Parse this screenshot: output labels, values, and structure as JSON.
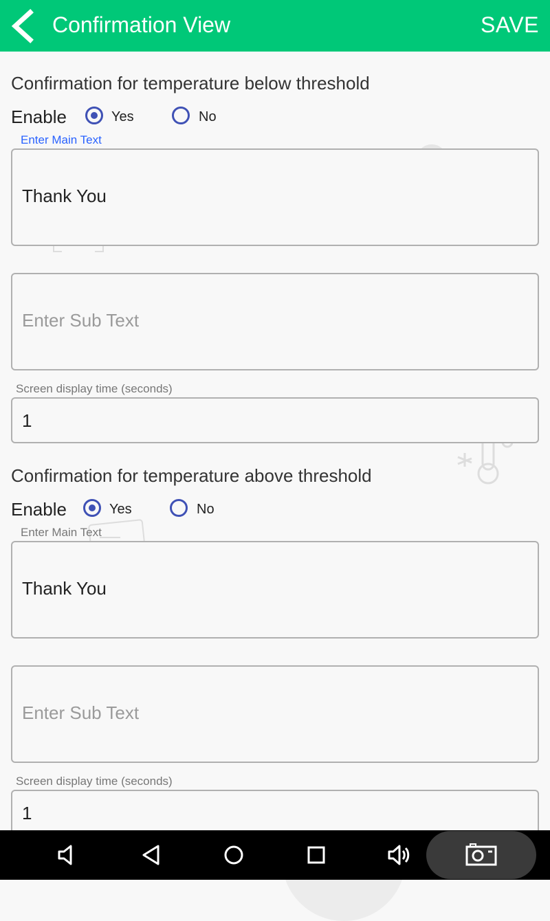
{
  "app_bar": {
    "title": "Confirmation View",
    "save_label": "SAVE",
    "background": "#00c878"
  },
  "sections": [
    {
      "title": "Confirmation for temperature below threshold",
      "enable_label": "Enable",
      "options": [
        "Yes",
        "No"
      ],
      "selected": "Yes",
      "main_text_label": "Enter Main Text",
      "main_text_value": "Thank You",
      "sub_text_placeholder": "Enter Sub Text",
      "display_time_label": "Screen display time (seconds)",
      "display_time_value": "1"
    },
    {
      "title": "Confirmation for temperature above threshold",
      "enable_label": "Enable",
      "options": [
        "Yes",
        "No"
      ],
      "selected": "Yes",
      "main_text_label": "Enter Main Text",
      "main_text_value": "Thank You",
      "sub_text_placeholder": "Enter Sub Text",
      "display_time_label": "Screen display time (seconds)",
      "display_time_value": "1"
    }
  ],
  "nav_bar": {
    "icons": [
      "volume-down-icon",
      "back-icon",
      "home-icon",
      "recents-icon",
      "volume-up-icon",
      "screenshot-icon"
    ]
  },
  "colors": {
    "accent": "#3f51b5",
    "focused_label": "#2962ff"
  }
}
